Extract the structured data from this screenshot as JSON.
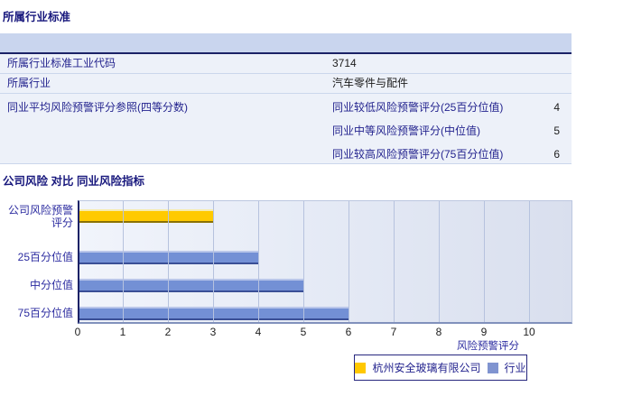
{
  "section1": {
    "title": "所属行业标准",
    "rows": [
      {
        "label": "所属行业标准工业代码",
        "value": "3714"
      },
      {
        "label": "所属行业",
        "value": "汽车零件与配件"
      }
    ],
    "quartile_row": {
      "label": "同业平均风险预警评分参照(四等分数)",
      "items": [
        {
          "label": "同业较低风险预警评分(25百分位值)",
          "value": "4"
        },
        {
          "label": "同业中等风险预警评分(中位值)",
          "value": "5"
        },
        {
          "label": "同业较高风险预警评分(75百分位值)",
          "value": "6"
        }
      ]
    }
  },
  "section2": {
    "title": "公司风险 对比 同业风险指标"
  },
  "chart_data": {
    "type": "bar",
    "orientation": "horizontal",
    "categories": [
      "公司风险预警评分",
      "25百分位值",
      "中分位值",
      "75百分位值"
    ],
    "values": [
      3,
      4,
      5,
      6
    ],
    "bar_series": [
      "company",
      "industry",
      "industry",
      "industry"
    ],
    "series_colors": {
      "company": "#FFCA00",
      "industry": "#7390D5"
    },
    "xlabel": "风险预警评分",
    "xlim": [
      0,
      10
    ],
    "xticks": [
      0,
      1,
      2,
      3,
      4,
      5,
      6,
      7,
      8,
      9,
      10
    ],
    "grid": "vertical",
    "legend_position": "bottom",
    "legend": [
      {
        "label": "杭州安全玻璃有限公司",
        "series": "company",
        "color": "#FFC800"
      },
      {
        "label": "行业",
        "series": "industry",
        "color": "#8094D0"
      }
    ],
    "plot_bg": "#E4E9F4",
    "gridline_color": "#B6C2DE",
    "axis_color": "#1B2266"
  }
}
